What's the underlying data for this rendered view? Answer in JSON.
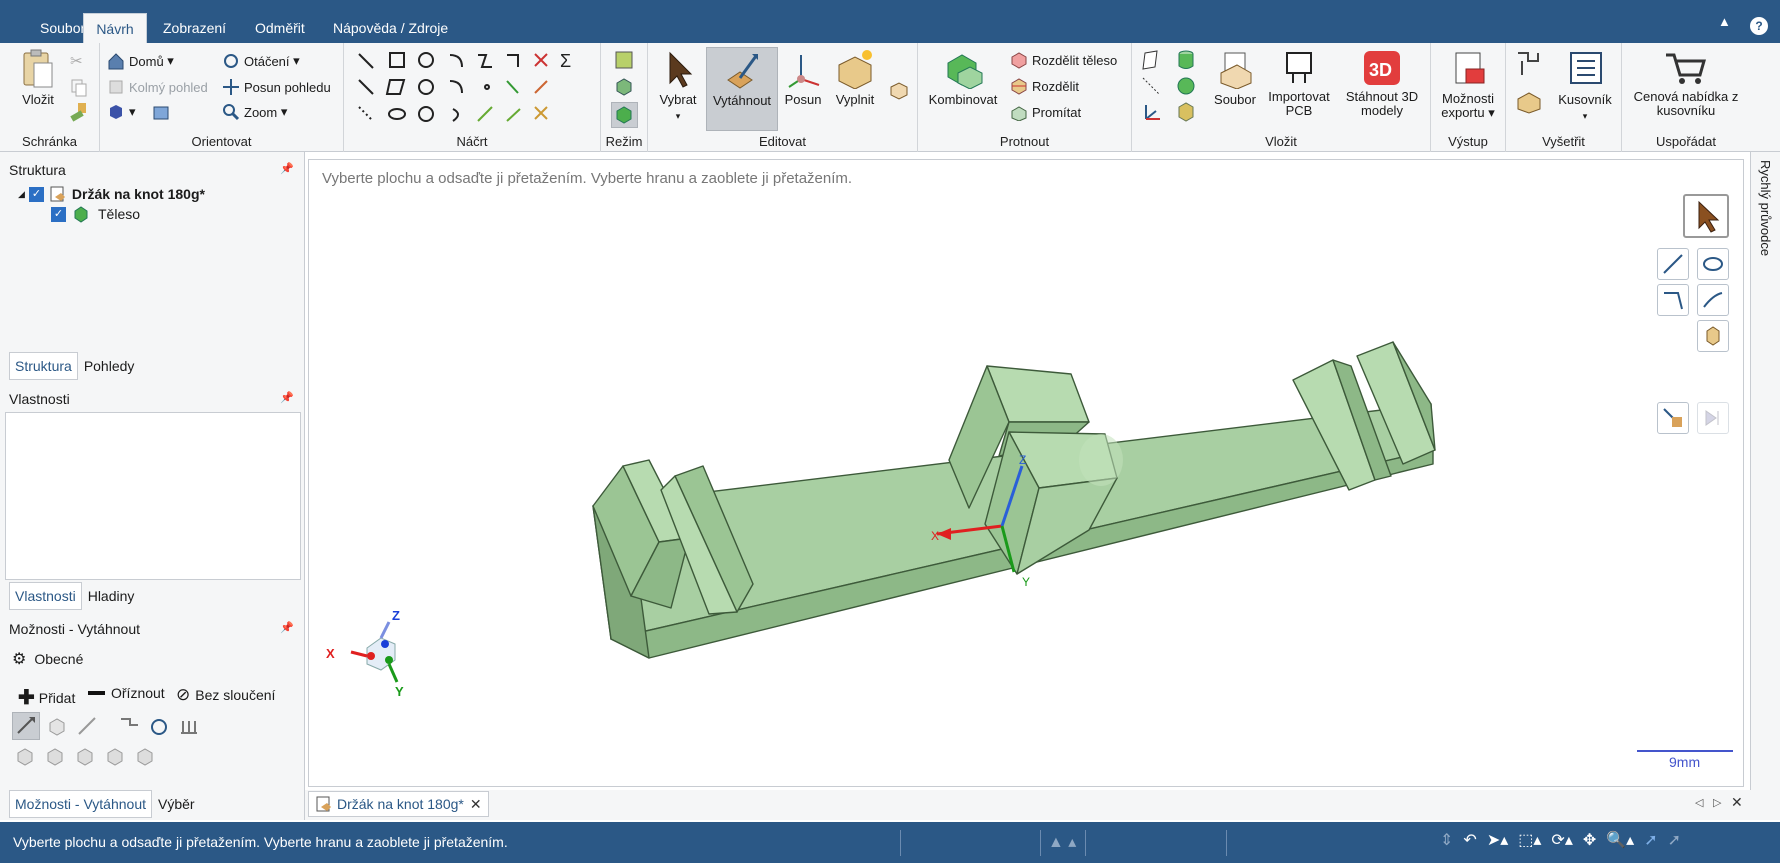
{
  "tabs": [
    "Soubor",
    "Návrh",
    "Zobrazení",
    "Odměřit",
    "Nápověda / Zdroje"
  ],
  "active_tab": "Návrh",
  "ribbon": {
    "schranka": {
      "label": "Schránka",
      "paste": "Vložit"
    },
    "orientovat": {
      "label": "Orientovat",
      "home": "Domů",
      "normal_view": "Kolmý pohled",
      "rotate": "Otáčení",
      "pan": "Posun pohledu",
      "zoom": "Zoom"
    },
    "nacrt": {
      "label": "Náčrt"
    },
    "rezim": {
      "label": "Režim"
    },
    "editovat": {
      "label": "Editovat",
      "select": "Vybrat",
      "pull": "Vytáhnout",
      "move": "Posun",
      "fill": "Vyplnit"
    },
    "protnout": {
      "label": "Protnout",
      "combine": "Kombinovat",
      "split_body": "Rozdělit těleso",
      "split": "Rozdělit",
      "project": "Promítat"
    },
    "vlozit": {
      "label": "Vložit",
      "file": "Soubor",
      "import_pcb": "Importovat PCB",
      "download_3d": "Stáhnout 3D modely"
    },
    "vystup": {
      "label": "Výstup",
      "export_options": "Možnosti exportu"
    },
    "vysetrit": {
      "label": "Vyšetřit",
      "bom": "Kusovník"
    },
    "usporadat": {
      "label": "Uspořádat",
      "quote": "Cenová nabídka z kusovníku"
    }
  },
  "structure": {
    "title": "Struktura",
    "root": "Držák na knot 180g*",
    "child": "Těleso",
    "tabs": [
      "Struktura",
      "Pohledy"
    ]
  },
  "properties": {
    "title": "Vlastnosti",
    "tabs": [
      "Vlastnosti",
      "Hladiny"
    ]
  },
  "options": {
    "title": "Možnosti - Vytáhnout",
    "general": "Obecné",
    "add": "Přidat",
    "cut": "Oříznout",
    "no_merge": "Bez sloučení",
    "tabs": [
      "Možnosti - Vytáhnout",
      "Výběr"
    ]
  },
  "viewport": {
    "hint": "Vyberte plochu a odsaďte ji přetažením. Vyberte hranu a zaoblete ji přetažením.",
    "scale": "9mm",
    "axis_x": "X",
    "axis_y": "Y",
    "axis_z": "Z"
  },
  "doc_tab": "Držák na knot 180g*",
  "right_panel": "Rychlý průvodce",
  "status_text": "Vyberte plochu a odsaďte ji přetažením. Vyberte hranu a zaoblete ji přetažením.",
  "colors": {
    "brand": "#2b5886",
    "model": "#a3cc9e",
    "model_edge": "#3d5a3a"
  }
}
